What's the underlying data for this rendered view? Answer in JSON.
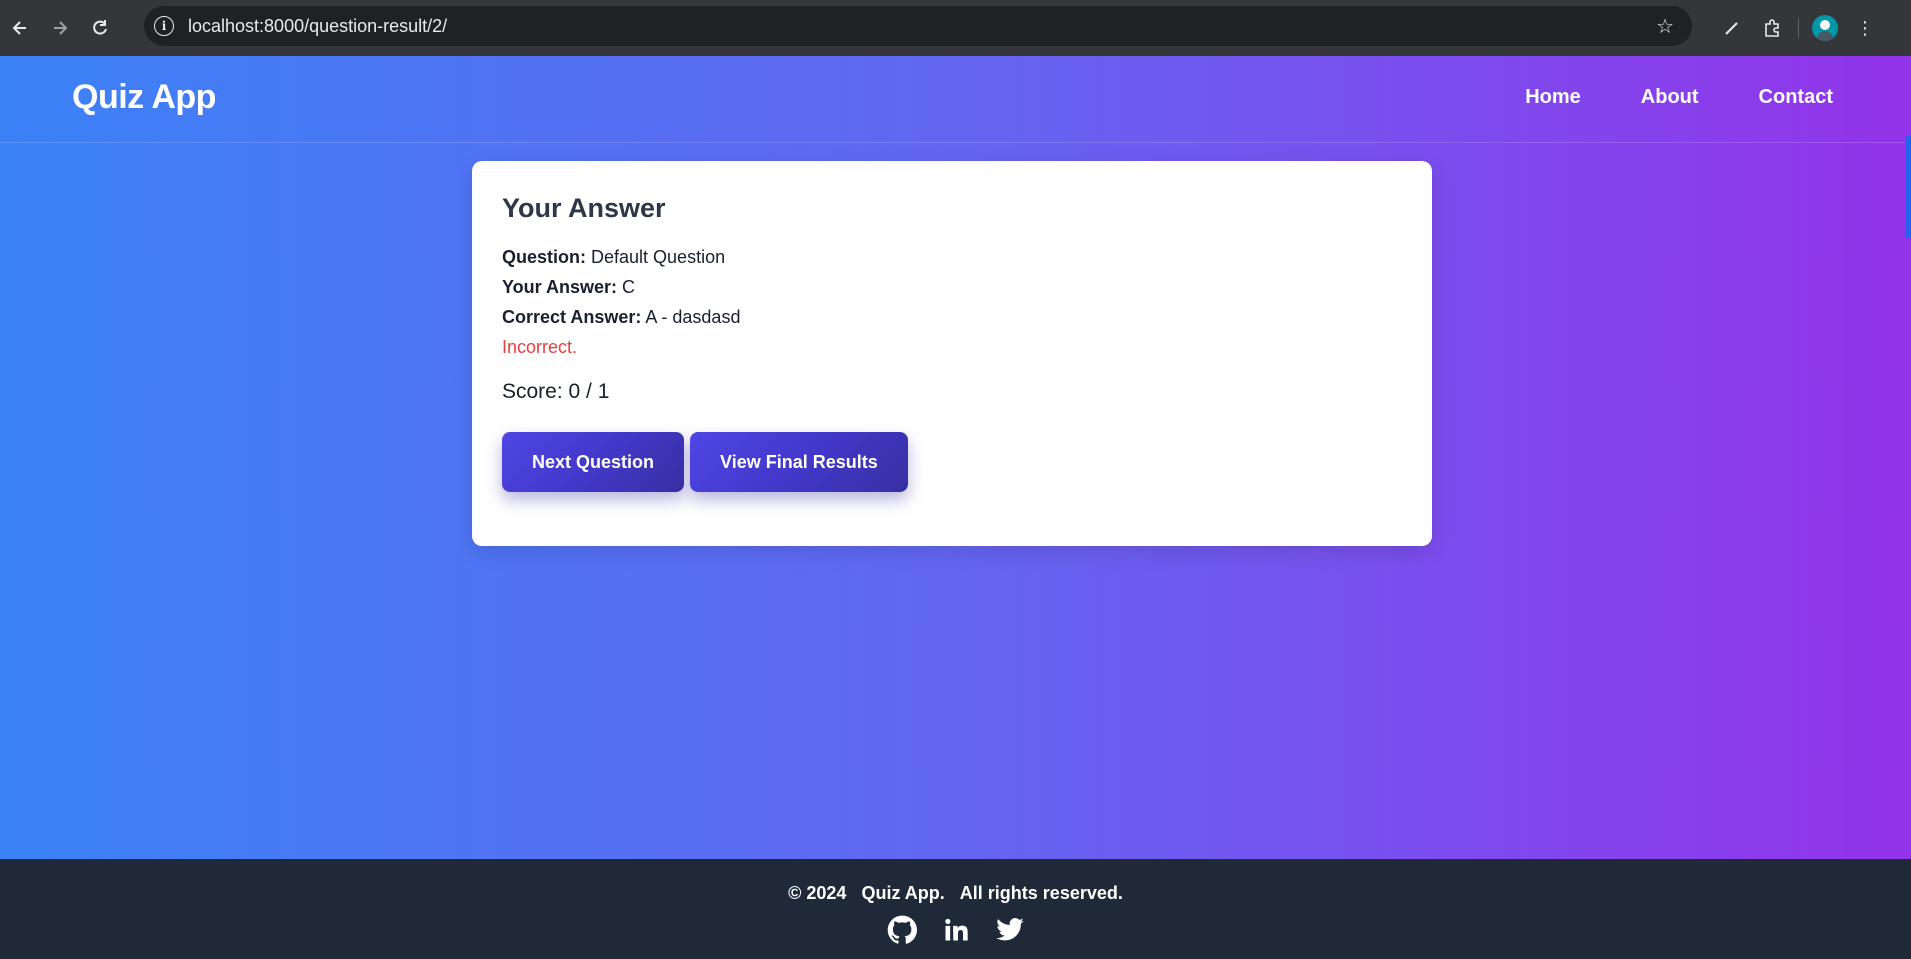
{
  "browser": {
    "url": "localhost:8000/question-result/2/",
    "back_icon": "arrow-left-icon",
    "forward_icon": "arrow-right-icon",
    "reload_icon": "reload-icon"
  },
  "header": {
    "brand": "Quiz App",
    "nav": [
      "Home",
      "About",
      "Contact"
    ]
  },
  "result": {
    "title": "Your Answer",
    "question_label": "Question:",
    "question_value": "Default Question",
    "your_answer_label": "Your Answer:",
    "your_answer_value": "C",
    "correct_answer_label": "Correct Answer:",
    "correct_answer_value": "A - dasdasd",
    "status": "Incorrect.",
    "score": "Score: 0 / 1",
    "next_button": "Next Question",
    "final_button": "View Final Results"
  },
  "footer": {
    "year": "© 2024",
    "app": "Quiz App.",
    "rights": "All rights reserved."
  },
  "colors": {
    "gradient_start": "#3b82f6",
    "gradient_end": "#9333ea",
    "incorrect": "#e53e3e",
    "footer_bg": "#1f2937"
  }
}
